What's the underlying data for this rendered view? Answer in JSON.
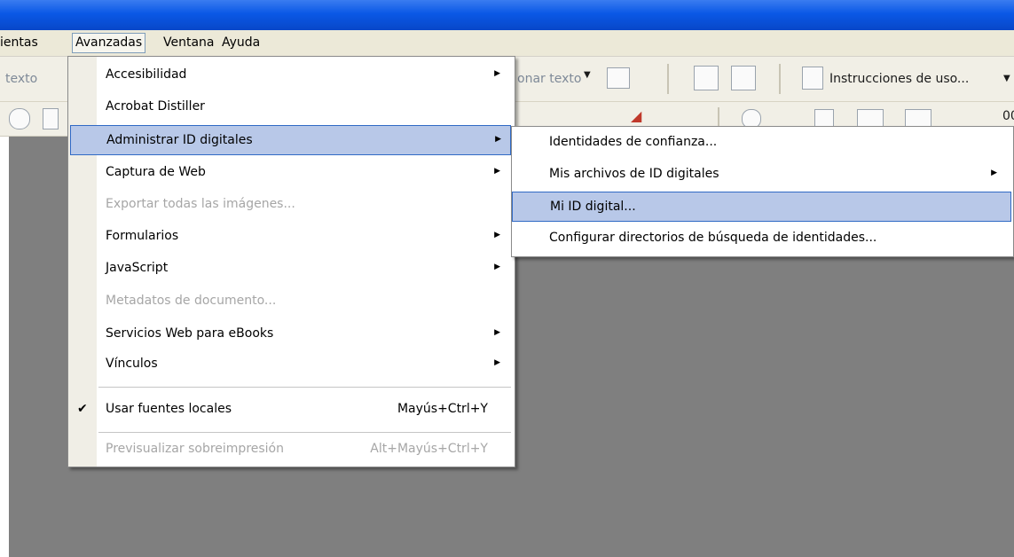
{
  "menubar": {
    "items": [
      "ientas",
      "Avanzadas",
      "Ventana",
      "Ayuda"
    ]
  },
  "toolbar": {
    "left_text": "texto",
    "mid_text": "onar texto",
    "instructions": "Instrucciones de uso...",
    "zoom_fragment": "00"
  },
  "main_menu": {
    "items": [
      {
        "label": "Accesibilidad",
        "submenu": true,
        "disabled": false
      },
      {
        "label": "Acrobat Distiller",
        "submenu": false,
        "disabled": false
      },
      {
        "label": "Administrar ID digitales",
        "submenu": true,
        "disabled": false,
        "highlighted": true
      },
      {
        "label": "Captura de Web",
        "submenu": true,
        "disabled": false
      },
      {
        "label": "Exportar todas las imágenes...",
        "submenu": false,
        "disabled": true
      },
      {
        "label": "Formularios",
        "submenu": true,
        "disabled": false
      },
      {
        "label": "JavaScript",
        "submenu": true,
        "disabled": false
      },
      {
        "label": "Metadatos de documento...",
        "submenu": false,
        "disabled": true
      },
      {
        "label": "Servicios Web para eBooks",
        "submenu": true,
        "disabled": false
      },
      {
        "label": "Vínculos",
        "submenu": true,
        "disabled": false
      }
    ],
    "check_item": {
      "label": "Usar fuentes locales",
      "shortcut": "Mayús+Ctrl+Y",
      "checked": true
    },
    "disabled_item": {
      "label": "Previsualizar sobreimpresión",
      "shortcut": "Alt+Mayús+Ctrl+Y"
    }
  },
  "sub_menu": {
    "items": [
      {
        "label": "Identidades de confianza...",
        "submenu": false
      },
      {
        "label": "Mis archivos de ID digitales",
        "submenu": true
      },
      {
        "label": "Mi ID digital...",
        "submenu": false,
        "highlighted": true
      },
      {
        "label": "Configurar directorios de búsqueda de identidades...",
        "submenu": false
      }
    ]
  },
  "colors": {
    "titlebar": "#0a58e6",
    "highlight": "#b8c8e8",
    "highlight_border": "#316ac5",
    "workarea": "#7f7f7f"
  }
}
